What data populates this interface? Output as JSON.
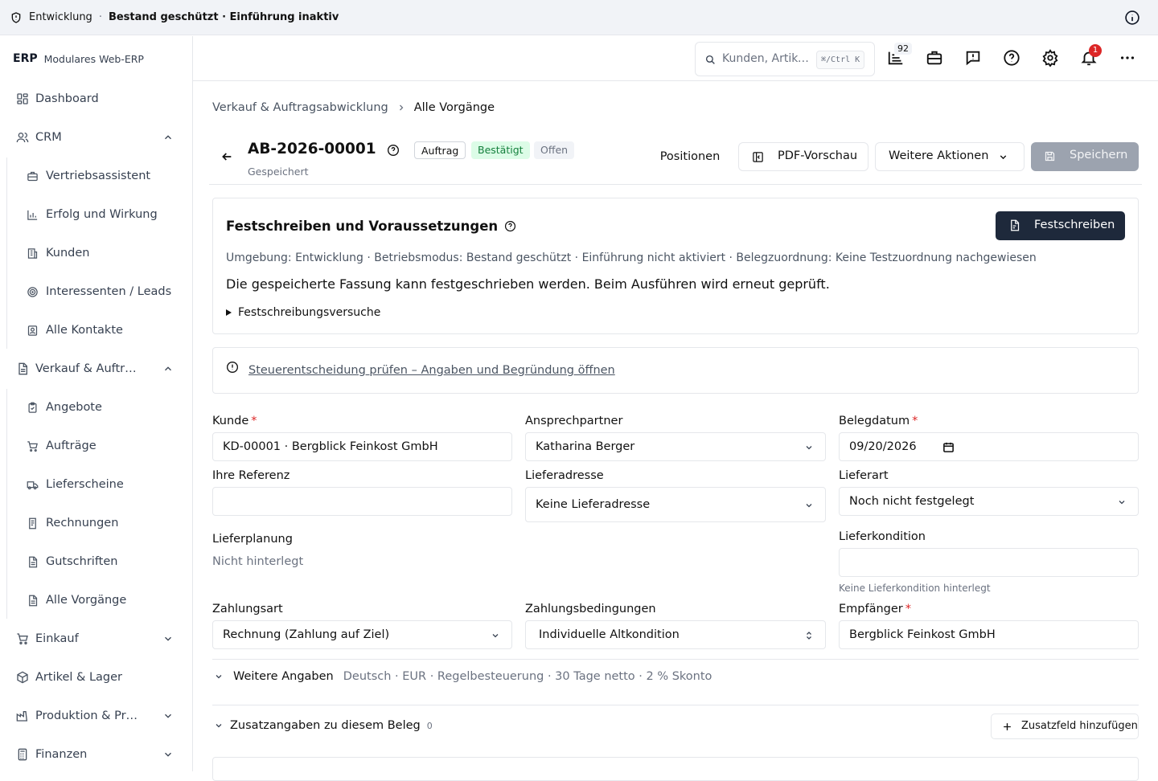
{
  "topbar": {
    "environment": "Entwicklung",
    "separator": "·",
    "state": "Bestand geschützt · Einführung inaktiv"
  },
  "brand": {
    "name": "ERP",
    "subtitle": "Modulares Web-ERP"
  },
  "sidebar": {
    "dashboard": "Dashboard",
    "crm": {
      "label": "CRM",
      "items": [
        "Vertriebsassistent",
        "Erfolg und Wirkung",
        "Kunden",
        "Interessenten / Leads",
        "Alle Kontakte"
      ]
    },
    "sales": {
      "label": "Verkauf & Auftr…",
      "items": [
        "Angebote",
        "Aufträge",
        "Lieferscheine",
        "Rechnungen",
        "Gutschriften",
        "Alle Vorgänge"
      ]
    },
    "purchase": "Einkauf",
    "inventory": "Artikel & Lager",
    "production": "Produktion & Pr…",
    "finance": "Finanzen"
  },
  "header": {
    "search_placeholder": "Kunden, Artikel…",
    "shortcut": "⌘/Ctrl K",
    "tasks_badge": "92",
    "notifications_badge": "1"
  },
  "breadcrumb": {
    "parent": "Verkauf & Auftragsabwicklung",
    "current": "Alle Vorgänge"
  },
  "document": {
    "number": "AB-2026-00001",
    "tags": {
      "type": "Auftrag",
      "status": "Bestätigt",
      "state": "Offen"
    },
    "saved_label": "Gespeichert",
    "actions": {
      "positions": "Positionen",
      "pdf": "PDF-Vorschau",
      "more": "Weitere Aktionen",
      "save": "Speichern"
    }
  },
  "finalize": {
    "title": "Festschreiben und Voraussetzungen",
    "button": "Festschreiben",
    "meta": "Umgebung: Entwicklung · Betriebsmodus: Bestand geschützt · Einführung nicht aktiviert · Belegzuordnung: Keine Testzuordnung nachgewiesen",
    "message": "Die gespeicherte Fassung kann festgeschrieben werden. Beim Ausführen wird erneut geprüft.",
    "attempts": "Festschreibungsversuche"
  },
  "tax_notice": {
    "link": "Steuerentscheidung prüfen – Angaben und Begründung öffnen"
  },
  "form": {
    "customer": {
      "label": "Kunde",
      "value": "KD-00001 · Bergblick Feinkost GmbH"
    },
    "contact": {
      "label": "Ansprechpartner",
      "value": "Katharina Berger"
    },
    "doc_date": {
      "label": "Belegdatum",
      "value": "09/20/2026"
    },
    "reference": {
      "label": "Ihre Referenz",
      "value": ""
    },
    "delivery_address": {
      "label": "Lieferadresse",
      "value": "Keine Lieferadresse"
    },
    "delivery_type": {
      "label": "Lieferart",
      "value": "Noch nicht festgelegt"
    },
    "delivery_planning": {
      "label": "Lieferplanung",
      "value": "Nicht hinterlegt"
    },
    "delivery_condition": {
      "label": "Lieferkondition",
      "value": "",
      "help": "Keine Lieferkondition hinterlegt"
    },
    "payment_method": {
      "label": "Zahlungsart",
      "value": "Rechnung (Zahlung auf Ziel)"
    },
    "payment_terms": {
      "label": "Zahlungsbedingungen",
      "value": "Individuelle Altkondition"
    },
    "recipient": {
      "label": "Empfänger",
      "value": "Bergblick Feinkost GmbH"
    },
    "required_mark": "*"
  },
  "more_details": {
    "label": "Weitere Angaben",
    "summary": "Deutsch · EUR · Regelbesteuerung · 30 Tage netto · 2 % Skonto"
  },
  "extra_fields": {
    "label": "Zusatzangaben zu diesem Beleg",
    "count": "0",
    "add_button": "Zusatzfeld hinzufügen"
  }
}
